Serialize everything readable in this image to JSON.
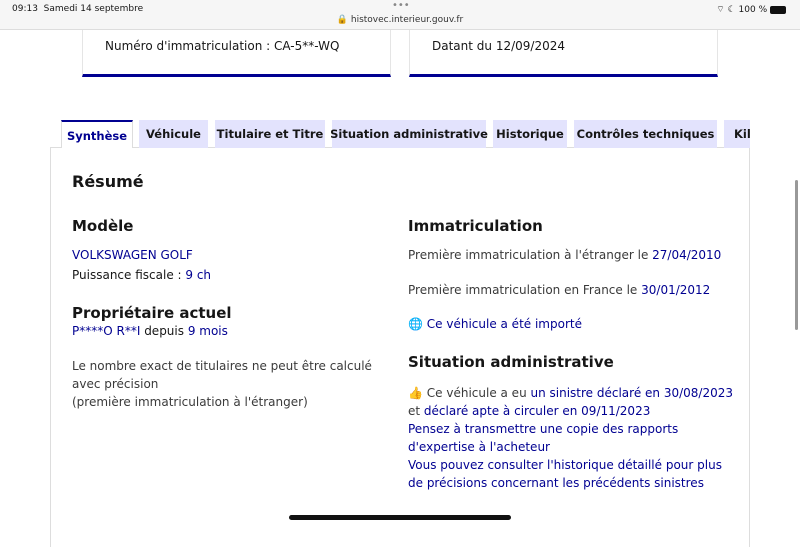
{
  "status_bar": {
    "time": "09:13",
    "date": "Samedi 14 septembre",
    "url": "histovec.interieur.gouv.fr",
    "battery": "100 %"
  },
  "cards": {
    "plate": "Numéro d'immatriculation : CA-5**-WQ",
    "date": "Datant du 12/09/2024"
  },
  "tabs": [
    "Synthèse",
    "Véhicule",
    "Titulaire et Titre",
    "Situation administrative",
    "Historique",
    "Contrôles techniques",
    "Kilométrage"
  ],
  "summary": {
    "title": "Résumé",
    "model": {
      "heading": "Modèle",
      "name": "VOLKSWAGEN GOLF",
      "power_label": "Puissance fiscale : ",
      "power_value": "9 ch"
    },
    "owner": {
      "heading": "Propriétaire actuel",
      "name": "P****O R**I",
      "since_label": " depuis ",
      "since_value": "9 mois",
      "note1": "Le nombre exact de titulaires ne peut être calculé avec précision",
      "note2": "(première immatriculation à l'étranger)"
    },
    "registration": {
      "heading": "Immatriculation",
      "foreign_label": "Première immatriculation à l'étranger le ",
      "foreign_date": "27/04/2010",
      "france_label": "Première immatriculation en France le ",
      "france_date": "30/01/2012",
      "imported": "Ce véhicule a été importé"
    },
    "admin": {
      "heading": "Situation administrative",
      "l1a": "Ce véhicule a eu ",
      "l1b": "un sinistre déclaré en 30/08/2023",
      "l2a": "et ",
      "l2b": "déclaré apte à circuler en 09/11/2023",
      "l3": "Pensez à transmettre une copie des rapports d'expertise à l'acheteur",
      "l4": "Vous pouvez consulter l'historique détaillé pour plus de précisions concernant les précédents sinistres"
    }
  }
}
